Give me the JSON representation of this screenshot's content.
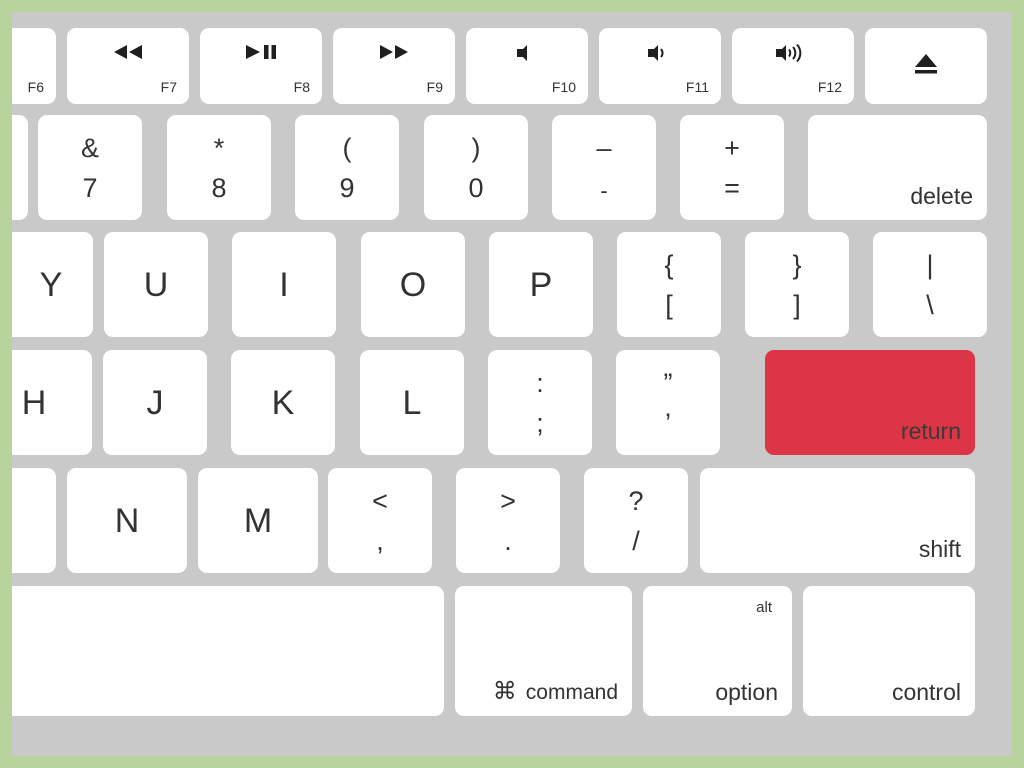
{
  "meta": {
    "device": "Apple wireless keyboard (close-up, right portion)",
    "frame_color": "#b8d49c",
    "deck_color": "#c9c9c9",
    "key_color": "#ffffff",
    "key_text_color": "#333333",
    "accent_color": "#dc3545",
    "highlighted_key": "return"
  },
  "rows": {
    "function_row": {
      "name": "function-row",
      "keys": [
        {
          "id": "f6",
          "legend_sub": "F6",
          "glyph": "",
          "icon": ""
        },
        {
          "id": "f7",
          "legend_sub": "F7",
          "glyph": "◀◀",
          "icon": "rewind-icon"
        },
        {
          "id": "f8",
          "legend_sub": "F8",
          "glyph": "▶❙❙",
          "icon": "play-pause-icon"
        },
        {
          "id": "f9",
          "legend_sub": "F9",
          "glyph": "▶▶",
          "icon": "fast-forward-icon"
        },
        {
          "id": "f10",
          "legend_sub": "F10",
          "glyph": "",
          "icon": "mute-icon"
        },
        {
          "id": "f11",
          "legend_sub": "F11",
          "glyph": "",
          "icon": "volume-down-icon"
        },
        {
          "id": "f12",
          "legend_sub": "F12",
          "glyph": "",
          "icon": "volume-up-icon"
        },
        {
          "id": "eject",
          "legend_sub": "",
          "glyph": "",
          "icon": "eject-icon"
        }
      ]
    },
    "number_row": {
      "name": "number-row",
      "keys": [
        {
          "id": "6-partial",
          "top": "",
          "bottom": ""
        },
        {
          "id": "7",
          "top": "&",
          "bottom": "7"
        },
        {
          "id": "8",
          "top": "*",
          "bottom": "8"
        },
        {
          "id": "9",
          "top": "(",
          "bottom": "9"
        },
        {
          "id": "0",
          "top": ")",
          "bottom": "0"
        },
        {
          "id": "minus",
          "top": "–",
          "bottom": "-"
        },
        {
          "id": "equal",
          "top": "+",
          "bottom": "="
        },
        {
          "id": "delete",
          "word": "delete"
        }
      ]
    },
    "top_letter_row": {
      "name": "qwerty-row",
      "keys": [
        {
          "id": "y",
          "letter": "Y"
        },
        {
          "id": "u",
          "letter": "U"
        },
        {
          "id": "i",
          "letter": "I"
        },
        {
          "id": "o",
          "letter": "O"
        },
        {
          "id": "p",
          "letter": "P"
        },
        {
          "id": "bracket-left",
          "top": "{",
          "bottom": "["
        },
        {
          "id": "bracket-right",
          "top": "}",
          "bottom": "]"
        },
        {
          "id": "backslash",
          "top": "|",
          "bottom": "\\"
        }
      ]
    },
    "home_row": {
      "name": "home-row",
      "keys": [
        {
          "id": "h",
          "letter": "H"
        },
        {
          "id": "j",
          "letter": "J"
        },
        {
          "id": "k",
          "letter": "K"
        },
        {
          "id": "l",
          "letter": "L"
        },
        {
          "id": "semicolon",
          "top": ":",
          "bottom": ";"
        },
        {
          "id": "quote",
          "top": "”",
          "bottom": "’"
        },
        {
          "id": "return",
          "word": "return",
          "highlighted": true
        }
      ]
    },
    "bottom_letter_row": {
      "name": "bottom-letter-row",
      "keys": [
        {
          "id": "b-partial",
          "letter": ""
        },
        {
          "id": "n",
          "letter": "N"
        },
        {
          "id": "m",
          "letter": "M"
        },
        {
          "id": "comma",
          "top": "<",
          "bottom": ","
        },
        {
          "id": "period",
          "top": ">",
          "bottom": "."
        },
        {
          "id": "slash",
          "top": "?",
          "bottom": "/"
        },
        {
          "id": "shift",
          "word": "shift"
        }
      ]
    },
    "modifier_row": {
      "name": "modifier-row",
      "keys": [
        {
          "id": "space",
          "word": ""
        },
        {
          "id": "command",
          "word": "command",
          "glyph": "⌘",
          "icon": "command-icon"
        },
        {
          "id": "option",
          "word": "option",
          "word_top": "alt"
        },
        {
          "id": "control",
          "word": "control"
        }
      ]
    }
  }
}
